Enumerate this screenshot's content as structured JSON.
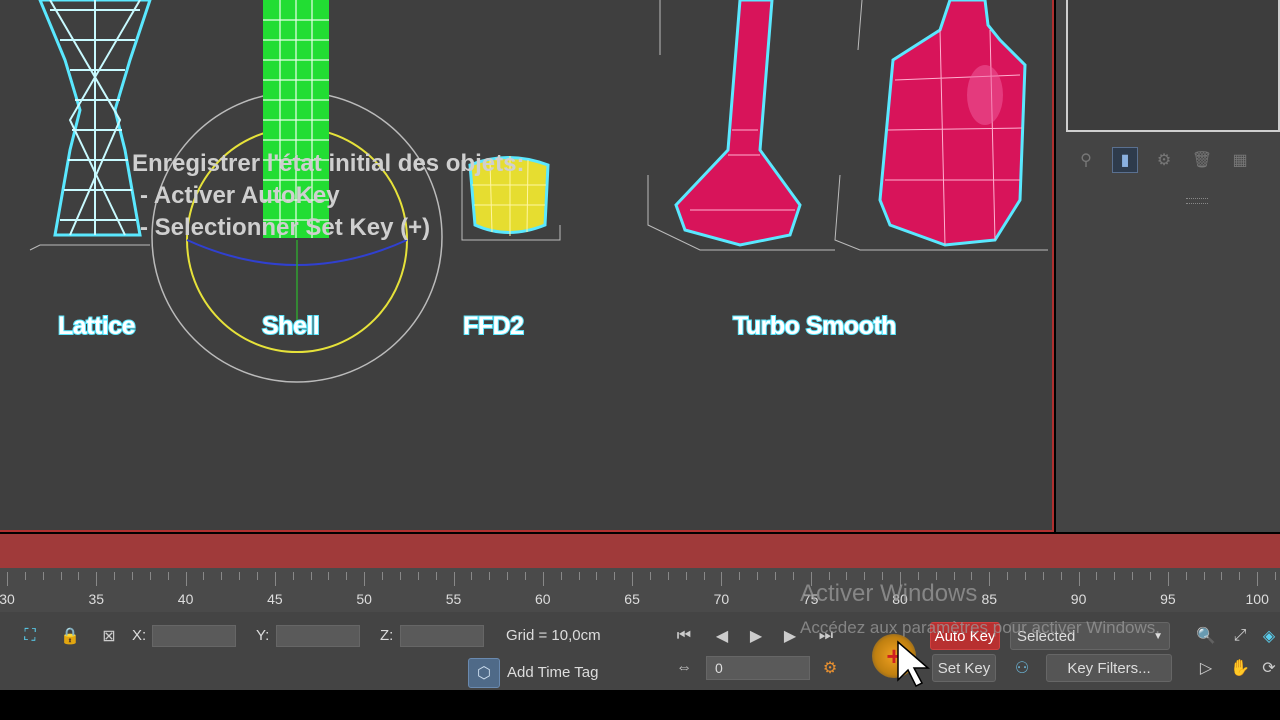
{
  "viewport": {
    "labels": {
      "lattice": "Lattice",
      "shell": "Shell",
      "ffd2": "FFD2",
      "turbosmooth": "Turbo Smooth"
    },
    "instructions": {
      "line1": "Enregistrer l'état initial des objets:",
      "line2": "- Activer AutoKey",
      "line3": "- Selectionner Set Key (+)"
    },
    "colors": {
      "background": "#3f3f3f",
      "wire": "#5ae8ff",
      "shell_green": "#22dd33",
      "bottle_pink": "#d8145a",
      "gizmo_yellow": "#e6e23a"
    }
  },
  "timeline": {
    "ticks": [
      "30",
      "35",
      "40",
      "45",
      "50",
      "55",
      "60",
      "65",
      "70",
      "75",
      "80",
      "85",
      "90",
      "95",
      "100"
    ]
  },
  "status": {
    "x_label": "X:",
    "y_label": "Y:",
    "z_label": "Z:",
    "grid": "Grid = 10,0cm",
    "add_time_tag": "Add Time Tag"
  },
  "animation": {
    "frame_value": "0",
    "auto_key": "Auto Key",
    "set_key": "Set Key",
    "selected": "Selected",
    "key_filters": "Key Filters...",
    "accent": "#c83232"
  },
  "watermark": {
    "line1": "Activer Windows",
    "line2": "Accédez aux paramètres pour activer Windows."
  }
}
